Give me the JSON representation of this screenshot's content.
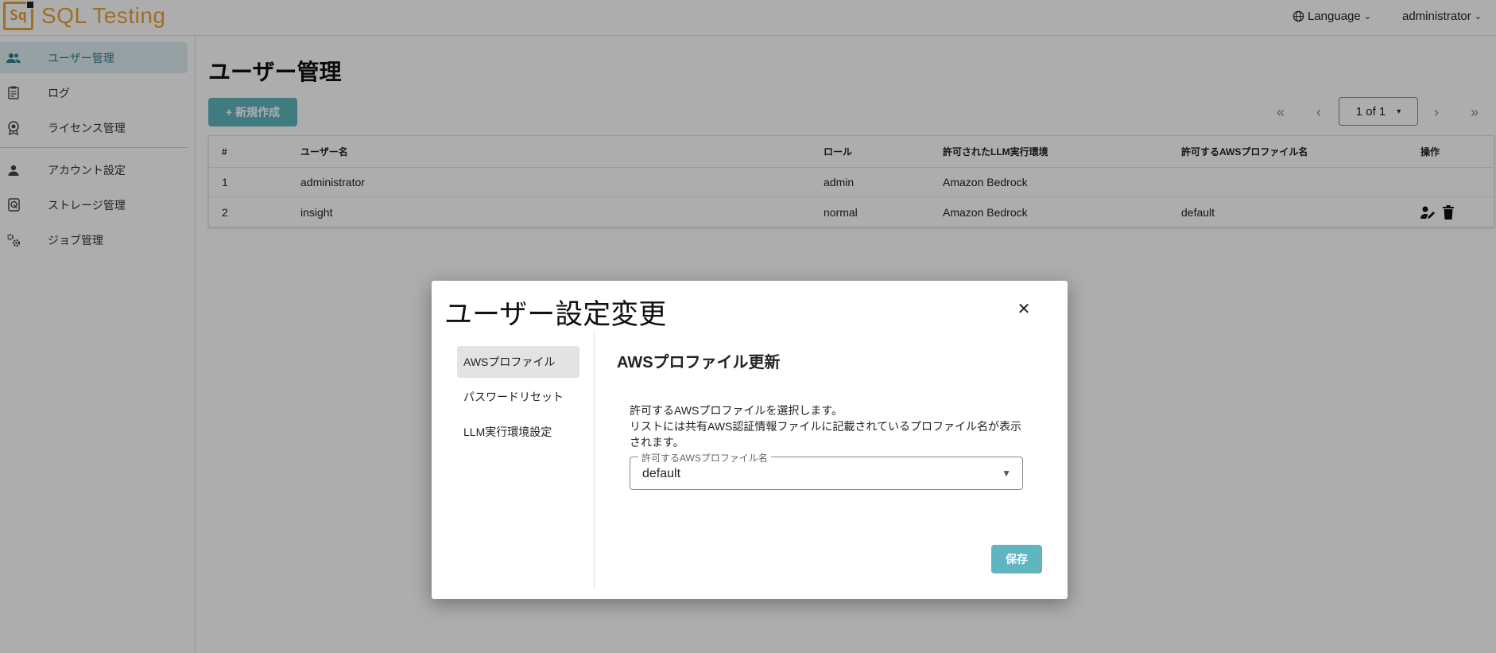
{
  "app": {
    "logo_mark": "Sq",
    "title": "SQL Testing"
  },
  "header": {
    "language_label": "Language",
    "user_label": "administrator"
  },
  "sidebar": {
    "items": [
      {
        "label": "ユーザー管理",
        "icon": "users-icon",
        "active": true
      },
      {
        "label": "ログ",
        "icon": "clipboard-icon",
        "active": false
      },
      {
        "label": "ライセンス管理",
        "icon": "badge-icon",
        "active": false
      },
      {
        "label": "アカウント設定",
        "icon": "person-icon",
        "active": false
      },
      {
        "label": "ストレージ管理",
        "icon": "storage-icon",
        "active": false
      },
      {
        "label": "ジョブ管理",
        "icon": "gears-icon",
        "active": false
      }
    ]
  },
  "main": {
    "title": "ユーザー管理",
    "new_button": "新規作成",
    "pagination": {
      "page_label": "1 of 1"
    }
  },
  "table": {
    "columns": [
      "#",
      "ユーザー名",
      "ロール",
      "許可されたLLM実行環境",
      "許可するAWSプロファイル名",
      "操作"
    ],
    "rows": [
      {
        "no": "1",
        "username": "administrator",
        "role": "admin",
        "llm": "Amazon Bedrock",
        "aws_profile": ""
      },
      {
        "no": "2",
        "username": "insight",
        "role": "normal",
        "llm": "Amazon Bedrock",
        "aws_profile": "default"
      }
    ]
  },
  "dialog": {
    "title": "ユーザー設定変更",
    "nav": [
      {
        "label": "AWSプロファイル",
        "active": true
      },
      {
        "label": "パスワードリセット",
        "active": false
      },
      {
        "label": "LLM実行環境設定",
        "active": false
      }
    ],
    "section_title": "AWSプロファイル更新",
    "description_line1": "許可するAWSプロファイルを選択します。",
    "description_line2": "リストには共有AWS認証情報ファイルに記載されているプロファイル名が表示されます。",
    "field_label": "許可するAWSプロファイル名",
    "field_value": "default",
    "save_button": "保存"
  },
  "colors": {
    "accent": "#5fb6c0",
    "logo": "#e8a33a",
    "active_nav_bg": "#dfeef0"
  }
}
